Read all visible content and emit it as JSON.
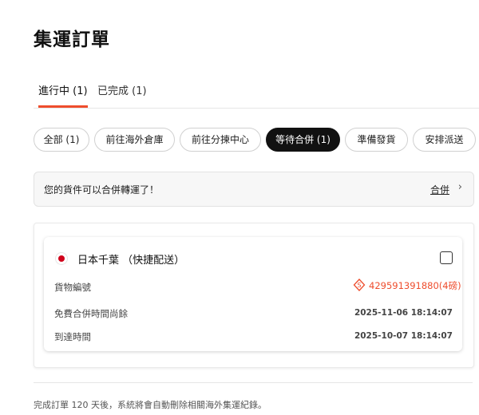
{
  "page": {
    "title": "集運訂單"
  },
  "tabs": [
    {
      "label": "進行中 (1)",
      "active": true
    },
    {
      "label": "已完成 (1)",
      "active": false
    }
  ],
  "filters": [
    {
      "label": "全部 (1)",
      "active": false
    },
    {
      "label": "前往海外倉庫",
      "active": false
    },
    {
      "label": "前往分揀中心",
      "active": false
    },
    {
      "label": "等待合併 (1)",
      "active": true
    },
    {
      "label": "準備發貨",
      "active": false
    },
    {
      "label": "安排派送",
      "active": false
    }
  ],
  "notice": {
    "text": "您的貨件可以合併轉運了！",
    "action_label": "合併",
    "chevron_icon": "chevron-right-icon"
  },
  "shipment": {
    "flag_icon": "japan-flag-icon",
    "title": "日本千葉 （快捷配送）",
    "rows": [
      {
        "label": "貨物編號",
        "value": "429591391880(4磅)",
        "icon": "shipping-fee-icon"
      },
      {
        "label": "免費合併時間尚餘",
        "value": "2025-11-06 18:14:07"
      },
      {
        "label": "到達時間",
        "value": "2025-10-07 18:14:07"
      }
    ]
  },
  "footer": {
    "note": "完成訂單 120 天後，系統將會自動刪除相關海外集運紀錄。"
  },
  "colors": {
    "accent": "#ee4d2d",
    "active_chip": "#111111",
    "flag_red": "#d0021b"
  }
}
